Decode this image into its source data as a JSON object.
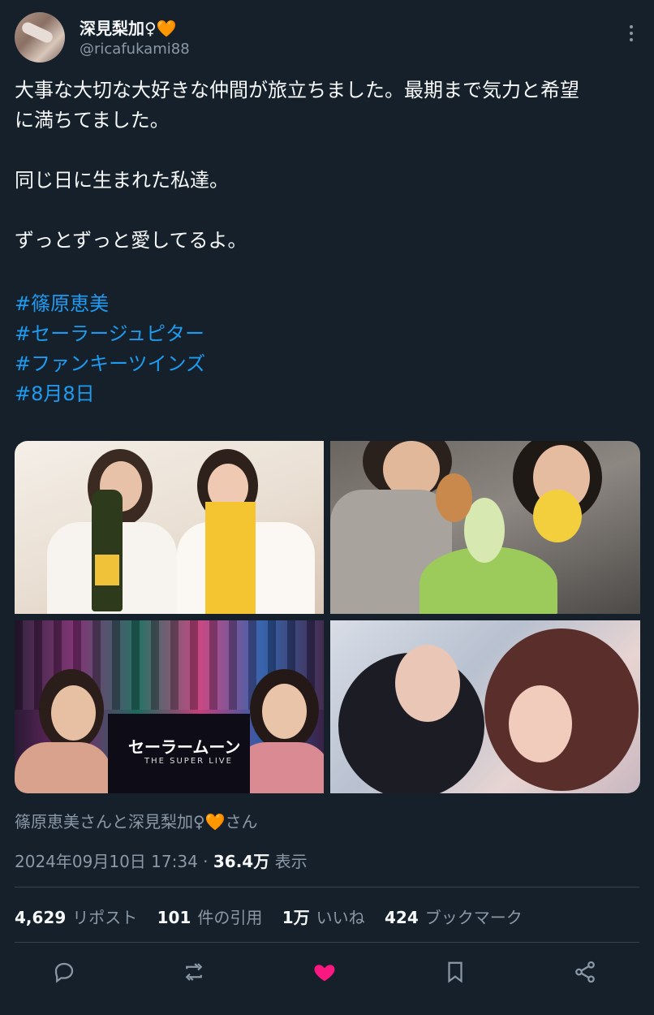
{
  "author": {
    "name": "深見梨加♀🧡",
    "handle": "@ricafukami88"
  },
  "tweet": {
    "lines": [
      "大事な大切な大好きな仲間が旅立ちました。最期まで気力と希望",
      "に満ちてました。",
      "同じ日に生まれた私達。",
      "ずっとずっと愛してるよ。"
    ],
    "hashtags": [
      "#篠原恵美",
      "#セーラージュピター",
      "#ファンキーツインズ",
      "#8月8日"
    ]
  },
  "media": {
    "photo3_poster_text": "セーラームーン",
    "photo3_poster_sub": "THE SUPER LIVE"
  },
  "mentions": "篠原恵美さんと深見梨加♀🧡さん",
  "timestamp": "2024年09月10日 17:34",
  "views_count": "36.4万",
  "views_label": "表示",
  "stats": {
    "reposts_count": "4,629",
    "reposts_label": "リポスト",
    "quotes_count": "101",
    "quotes_label": "件の引用",
    "likes_count": "1万",
    "likes_label": "いいね",
    "bookmarks_count": "424",
    "bookmarks_label": "ブックマーク"
  },
  "icons": [
    "more-icon",
    "reply-icon",
    "repost-icon",
    "like-icon",
    "bookmark-icon",
    "share-icon"
  ],
  "colors": {
    "background": "#15202b",
    "link": "#1d9bf0",
    "like": "#f91880",
    "muted": "#8b98a5"
  }
}
